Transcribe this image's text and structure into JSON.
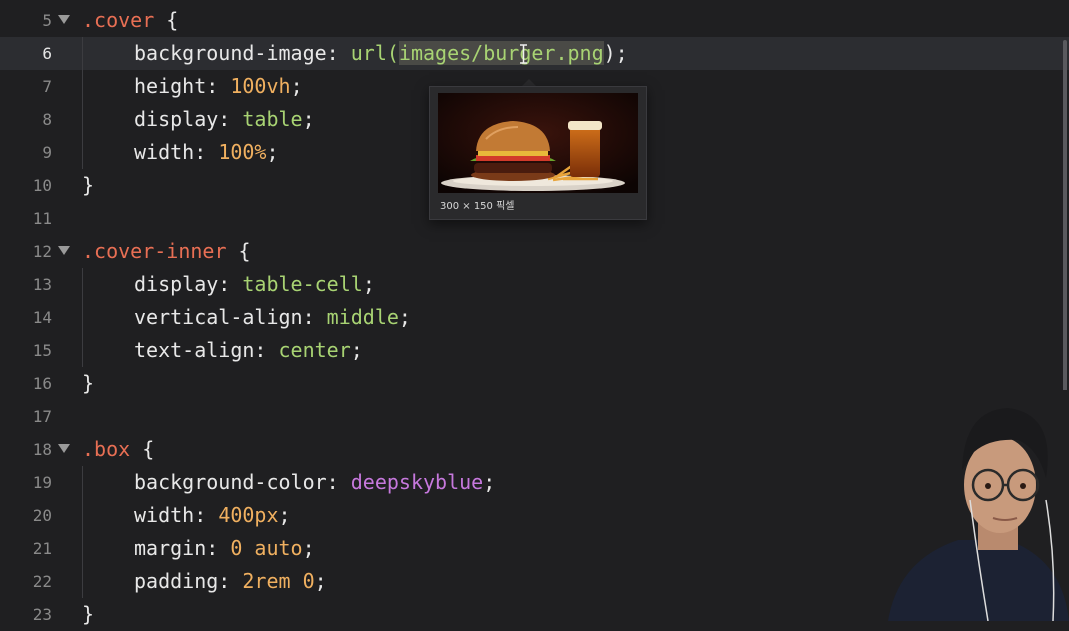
{
  "editor": {
    "lines": [
      {
        "num": "5",
        "fold": true,
        "tokens": [
          {
            "t": ".cover",
            "c": "sel"
          },
          {
            "t": " {",
            "c": "punct"
          }
        ],
        "indent": 0
      },
      {
        "num": "6",
        "active": true,
        "tokens": [
          {
            "t": "background-image",
            "c": "prop"
          },
          {
            "t": ": ",
            "c": "punct"
          },
          {
            "t": "url(",
            "c": "func"
          },
          {
            "t": "images/burger.png",
            "c": "str"
          },
          {
            "t": ");",
            "c": "punct"
          }
        ],
        "indent": 1
      },
      {
        "num": "7",
        "tokens": [
          {
            "t": "height",
            "c": "prop"
          },
          {
            "t": ": ",
            "c": "punct"
          },
          {
            "t": "100vh",
            "c": "num"
          },
          {
            "t": ";",
            "c": "punct"
          }
        ],
        "indent": 1
      },
      {
        "num": "8",
        "tokens": [
          {
            "t": "display",
            "c": "prop"
          },
          {
            "t": ": ",
            "c": "punct"
          },
          {
            "t": "table",
            "c": "kw"
          },
          {
            "t": ";",
            "c": "punct"
          }
        ],
        "indent": 1
      },
      {
        "num": "9",
        "tokens": [
          {
            "t": "width",
            "c": "prop"
          },
          {
            "t": ": ",
            "c": "punct"
          },
          {
            "t": "100%",
            "c": "num"
          },
          {
            "t": ";",
            "c": "punct"
          }
        ],
        "indent": 1
      },
      {
        "num": "10",
        "tokens": [
          {
            "t": "}",
            "c": "punct"
          }
        ],
        "indent": 0
      },
      {
        "num": "11",
        "tokens": [],
        "indent": 0
      },
      {
        "num": "12",
        "fold": true,
        "tokens": [
          {
            "t": ".cover-inner",
            "c": "sel"
          },
          {
            "t": " {",
            "c": "punct"
          }
        ],
        "indent": 0
      },
      {
        "num": "13",
        "tokens": [
          {
            "t": "display",
            "c": "prop"
          },
          {
            "t": ": ",
            "c": "punct"
          },
          {
            "t": "table-cell",
            "c": "kw"
          },
          {
            "t": ";",
            "c": "punct"
          }
        ],
        "indent": 1
      },
      {
        "num": "14",
        "tokens": [
          {
            "t": "vertical-align",
            "c": "prop"
          },
          {
            "t": ": ",
            "c": "punct"
          },
          {
            "t": "middle",
            "c": "kw"
          },
          {
            "t": ";",
            "c": "punct"
          }
        ],
        "indent": 1
      },
      {
        "num": "15",
        "tokens": [
          {
            "t": "text-align",
            "c": "prop"
          },
          {
            "t": ": ",
            "c": "punct"
          },
          {
            "t": "center",
            "c": "kw"
          },
          {
            "t": ";",
            "c": "punct"
          }
        ],
        "indent": 1
      },
      {
        "num": "16",
        "tokens": [
          {
            "t": "}",
            "c": "punct"
          }
        ],
        "indent": 0
      },
      {
        "num": "17",
        "tokens": [],
        "indent": 0
      },
      {
        "num": "18",
        "fold": true,
        "tokens": [
          {
            "t": ".box",
            "c": "sel"
          },
          {
            "t": " {",
            "c": "punct"
          }
        ],
        "indent": 0
      },
      {
        "num": "19",
        "tokens": [
          {
            "t": "background-color",
            "c": "prop"
          },
          {
            "t": ": ",
            "c": "punct"
          },
          {
            "t": "deepskyblue",
            "c": "purple"
          },
          {
            "t": ";",
            "c": "punct"
          }
        ],
        "indent": 1
      },
      {
        "num": "20",
        "tokens": [
          {
            "t": "width",
            "c": "prop"
          },
          {
            "t": ": ",
            "c": "punct"
          },
          {
            "t": "400px",
            "c": "num"
          },
          {
            "t": ";",
            "c": "punct"
          }
        ],
        "indent": 1
      },
      {
        "num": "21",
        "tokens": [
          {
            "t": "margin",
            "c": "prop"
          },
          {
            "t": ": ",
            "c": "punct"
          },
          {
            "t": "0 auto",
            "c": "num"
          },
          {
            "t": ";",
            "c": "punct"
          }
        ],
        "indent": 1
      },
      {
        "num": "22",
        "tokens": [
          {
            "t": "padding",
            "c": "prop"
          },
          {
            "t": ": ",
            "c": "punct"
          },
          {
            "t": "2rem 0",
            "c": "num"
          },
          {
            "t": ";",
            "c": "punct"
          }
        ],
        "indent": 1
      },
      {
        "num": "23",
        "tokens": [
          {
            "t": "}",
            "c": "punct"
          }
        ],
        "indent": 0
      }
    ]
  },
  "tooltip": {
    "caption": "300 × 150 픽셀",
    "image_subject": "burger-and-beer-thumbnail"
  },
  "colors": {
    "background": "#1f1f21",
    "selector": "#e86f54",
    "number": "#f0b060",
    "keyword": "#a8d373",
    "color_value": "#c678dd"
  }
}
